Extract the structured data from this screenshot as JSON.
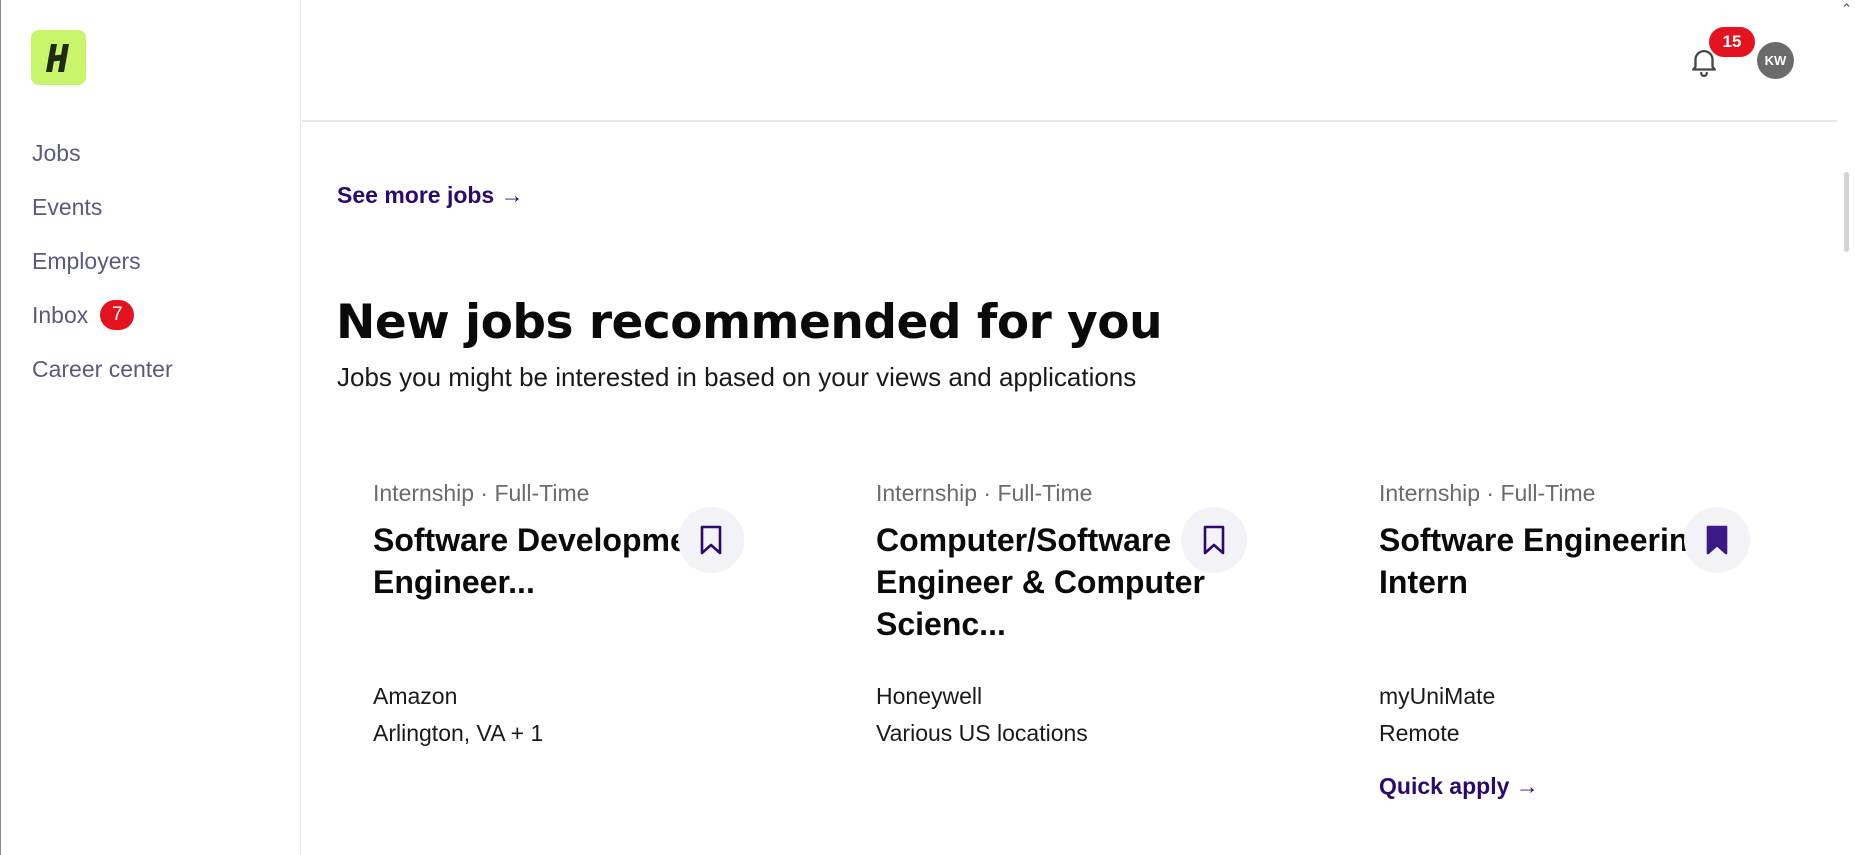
{
  "nav": {
    "items": [
      {
        "label": "Jobs"
      },
      {
        "label": "Events"
      },
      {
        "label": "Employers"
      },
      {
        "label": "Inbox",
        "badge": "7"
      },
      {
        "label": "Career center"
      }
    ]
  },
  "topbar": {
    "notification_count": "15",
    "avatar_initials": "KW"
  },
  "main": {
    "see_more_link": "See more jobs →",
    "section_title": "New jobs recommended for you",
    "section_subtitle": "Jobs you might be interested in based on your views and applications",
    "cards": [
      {
        "type": "Internship · Full-Time",
        "title": "Software Development Engineer...",
        "company": "Amazon",
        "location": "Arlington, VA + 1",
        "saved": false
      },
      {
        "type": "Internship · Full-Time",
        "title": "Computer/Software Engineer & Computer Scienc...",
        "company": "Honeywell",
        "location": "Various US locations",
        "saved": false
      },
      {
        "type": "Internship · Full-Time",
        "title": "Software Engineering Intern",
        "company": "myUniMate",
        "location": "Remote",
        "saved": true,
        "quick_apply": "Quick apply →"
      }
    ]
  },
  "icons": {
    "logo": "handshake-logo-icon",
    "bell": "bell-icon",
    "bookmark": "bookmark-icon",
    "scroll_up": "chevron-up-icon"
  },
  "colors": {
    "brand_lime": "#c8f56a",
    "accent_purple": "#2b0a6b",
    "badge_red": "#e4131f"
  }
}
